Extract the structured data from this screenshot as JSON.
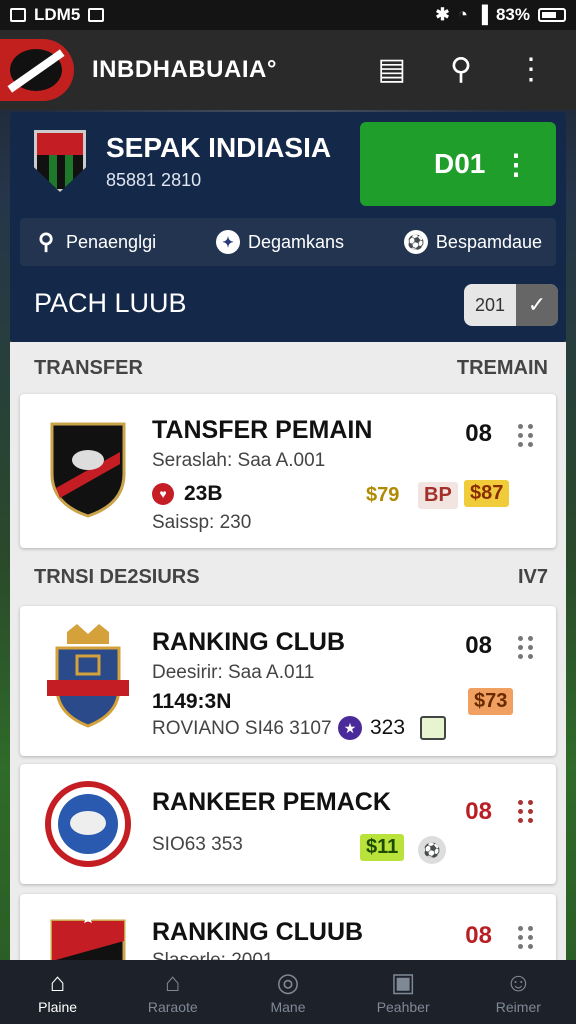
{
  "status_bar": {
    "left_text": "LDM5",
    "right_text": "83%"
  },
  "app_bar": {
    "title": "INBDHABUAIA°",
    "icons": [
      "news-icon",
      "search-icon",
      "more-vert-icon"
    ]
  },
  "club_header": {
    "name": "SEPAK INDIASIA",
    "subtitle": "85881 2810",
    "action_label": "D01",
    "action_menu": "⋮"
  },
  "filters": [
    {
      "label": "Penaenglgi",
      "icon": "search-icon"
    },
    {
      "label": "Degamkans",
      "icon": "star-icon"
    },
    {
      "label": "Bespamdaue",
      "icon": "ball-icon"
    }
  ],
  "section_title": "PACH LUUB",
  "year_toggle": {
    "value": "201",
    "icon": "chevron-check-icon"
  },
  "sections": [
    {
      "left": "TRANSFER",
      "right": "TREMAIN"
    },
    {
      "left": "TRNSI DE2SIURS",
      "right": "IV7"
    }
  ],
  "cards": [
    {
      "title": "TANSFER PEMAIN",
      "line1": "Seraslah: Saa A.001",
      "line2_badge": "23B",
      "line3": "Saissp: 230",
      "number": "08",
      "tags": [
        "$79",
        "BP",
        "$87"
      ]
    },
    {
      "title": "RANKING CLUB",
      "line1": "Deesirir: Saa A.011",
      "line2": "1149:3N",
      "line3": "ROVIANO SI46 3107",
      "line3_badge": "323",
      "number": "08",
      "tags": [
        "$73"
      ]
    },
    {
      "title": "RANKEER PEMACK",
      "line1": "SIO63 353",
      "number": "08",
      "tags": [
        "$11"
      ]
    },
    {
      "title": "RANKING CLUUB",
      "line1": "Slaserle: 2001",
      "number": "08",
      "tags": []
    }
  ],
  "bottom_nav": [
    {
      "label": "Plaine",
      "icon": "home-icon",
      "active": true
    },
    {
      "label": "Raraote",
      "icon": "house-icon",
      "active": false
    },
    {
      "label": "Mane",
      "icon": "ball-icon",
      "active": false
    },
    {
      "label": "Peahber",
      "icon": "box-icon",
      "active": false
    },
    {
      "label": "Reimer",
      "icon": "person-icon",
      "active": false
    }
  ],
  "colors": {
    "accent_green": "#1f9e2b",
    "panel_navy": "#14284a",
    "club_red": "#c41e24"
  }
}
